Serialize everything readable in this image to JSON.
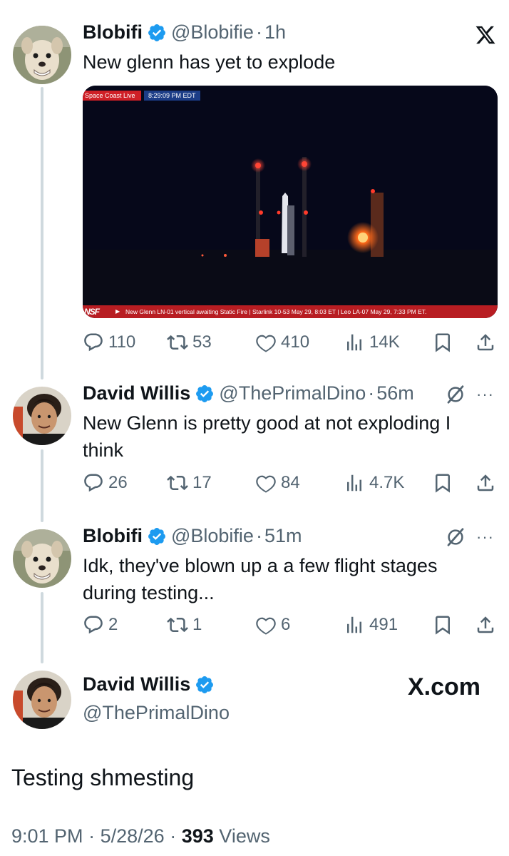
{
  "colors": {
    "verified": "#1d9bf0",
    "text": "#0f1419",
    "muted": "#536471",
    "thread_line": "#cfd9de"
  },
  "tweets": [
    {
      "name": "Blobifi",
      "handle": "@Blobifie",
      "separator": "·",
      "time": "1h",
      "text": "New glenn has yet to explode",
      "media": {
        "live_tag": "Space Coast Live",
        "time_tag": "8:29:09 PM EDT",
        "ticker_logo": "NSF",
        "ticker_text": "New Glenn LN-01 vertical awaiting Static Fire | Starlink 10-53 May 29, 8:03 ET | Leo LA-07 May 29, 7:33 PM ET."
      },
      "stats": {
        "replies": "110",
        "reposts": "53",
        "likes": "410",
        "views": "14K"
      }
    },
    {
      "name": "David Willis",
      "handle": "@ThePrimalDino",
      "separator": "·",
      "time": "56m",
      "text": "New Glenn is pretty good at not exploding I think",
      "stats": {
        "replies": "26",
        "reposts": "17",
        "likes": "84",
        "views": "4.7K"
      }
    },
    {
      "name": "Blobifi",
      "handle": "@Blobifie",
      "separator": "·",
      "time": "51m",
      "text": "Idk, they've blown up a a few flight stages during testing...",
      "stats": {
        "replies": "2",
        "reposts": "1",
        "likes": "6",
        "views": "491"
      }
    }
  ],
  "main_tweet": {
    "name": "David Willis",
    "handle": "@ThePrimalDino",
    "brand": "X.com",
    "text": "Testing shmesting",
    "time": "9:01 PM",
    "separator": "·",
    "date": "5/28/26",
    "views_count": "393",
    "views_label": "Views"
  },
  "icons": [
    "x-logo-icon",
    "more-icon",
    "grok-icon",
    "verified-badge-icon",
    "reply-icon",
    "repost-icon",
    "like-icon",
    "views-icon",
    "bookmark-icon",
    "share-icon"
  ]
}
